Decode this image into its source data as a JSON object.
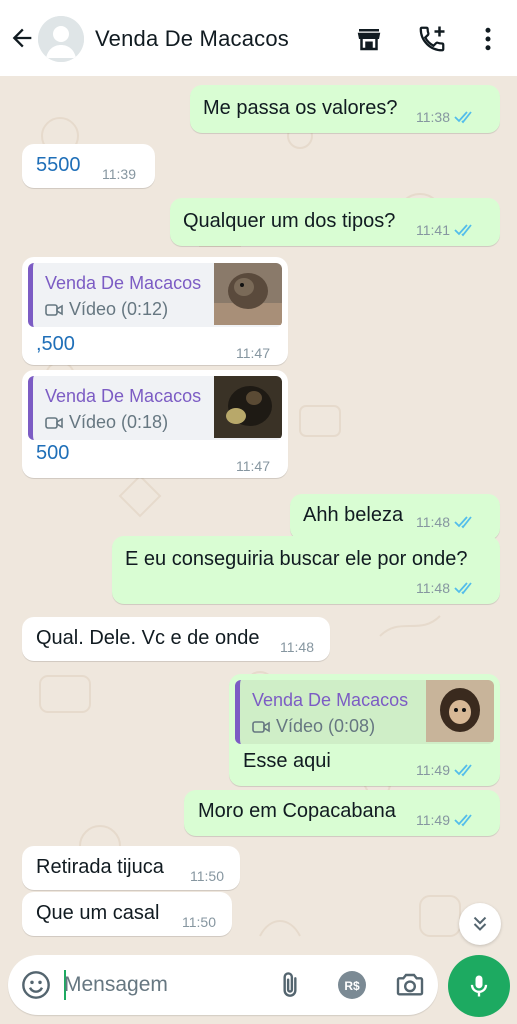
{
  "header": {
    "contact_name": "Venda De Macacos"
  },
  "messages": [
    {
      "text": "Me passa os valores?",
      "time": "11:38",
      "dir": "out",
      "read": true
    },
    {
      "text": "5500",
      "time": "11:39",
      "dir": "in"
    },
    {
      "text": "Qualquer um dos tipos?",
      "time": "11:41",
      "dir": "out",
      "read": true
    },
    {
      "text": ",500",
      "time": "11:47",
      "dir": "in",
      "quote": {
        "sender": "Venda De Macacos",
        "media": "Vídeo (0:12)"
      }
    },
    {
      "text": "500",
      "time": "11:47",
      "dir": "in",
      "quote": {
        "sender": "Venda De Macacos",
        "media": "Vídeo (0:18)"
      }
    },
    {
      "text": "Ahh beleza",
      "time": "11:48",
      "dir": "out",
      "read": true
    },
    {
      "text": "E eu conseguiria buscar ele por onde?",
      "time": "11:48",
      "dir": "out",
      "read": true
    },
    {
      "text": "Qual. Dele. Vc e de onde",
      "time": "11:48",
      "dir": "in"
    },
    {
      "text": "Esse aqui",
      "time": "11:49",
      "dir": "out",
      "read": true,
      "quote": {
        "sender": "Venda De Macacos",
        "media": "Vídeo (0:08)"
      }
    },
    {
      "text": "Moro em Copacabana",
      "time": "11:49",
      "dir": "out",
      "read": true
    },
    {
      "text": "Retirada tijuca",
      "time": "11:50",
      "dir": "in"
    },
    {
      "text": "Que um casal",
      "time": "11:50",
      "dir": "in"
    }
  ],
  "composer": {
    "placeholder": "Mensagem"
  },
  "icons": {
    "back": "arrow-left-icon",
    "catalog": "storefront-icon",
    "call": "add-call-icon",
    "menu": "more-vert-icon",
    "emoji": "emoji-icon",
    "attach": "paperclip-icon",
    "payment": "real-currency-icon",
    "camera": "camera-icon",
    "mic": "microphone-icon",
    "scroll": "double-chevron-down-icon"
  },
  "colors": {
    "outgoing_bubble": "#d9fdd3",
    "incoming_bubble": "#ffffff",
    "quote_accent": "#7c5cc4",
    "read_ticks": "#53bdeb",
    "mic_button": "#1daa61",
    "price_text": "#1f6fb8"
  }
}
